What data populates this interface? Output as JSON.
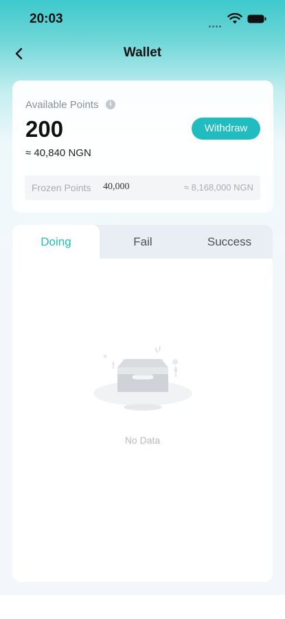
{
  "status_bar": {
    "time": "20:03"
  },
  "nav": {
    "title": "Wallet"
  },
  "points": {
    "available_label": "Available Points",
    "info_icon": "i",
    "value": "200",
    "ngn_approx": "≈ 40,840 NGN",
    "withdraw_label": "Withdraw",
    "frozen_label": "Frozen Points",
    "frozen_value": "40,000",
    "frozen_ngn": "≈ 8,168,000 NGN"
  },
  "tabs": [
    {
      "label": "Doing",
      "active": true
    },
    {
      "label": "Fail",
      "active": false
    },
    {
      "label": "Success",
      "active": false
    }
  ],
  "empty_state": {
    "text": "No Data"
  },
  "colors": {
    "accent": "#1fbdbf",
    "header_gradient_top": "#3ec9cc"
  }
}
